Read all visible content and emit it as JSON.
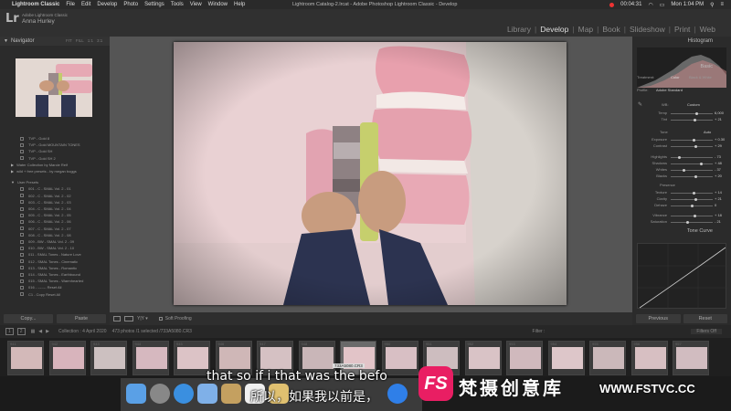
{
  "menubar": {
    "apple": "",
    "items": [
      "Lightroom Classic",
      "File",
      "Edit",
      "Develop",
      "Photo",
      "Settings",
      "Tools",
      "View",
      "Window",
      "Help"
    ],
    "window_title": "Lightroom Catalog-2.lrcat - Adobe Photoshop Lightroom Classic - Develop",
    "timer": "00:04:31",
    "clock": "Mon 1:04 PM"
  },
  "header": {
    "logo": "Lr",
    "product": "Adobe Lightroom Classic",
    "user": "Anna Hurley",
    "modules": [
      "Library",
      "Develop",
      "Map",
      "Book",
      "Slideshow",
      "Print",
      "Web"
    ],
    "active_module": "Develop"
  },
  "left_panel": {
    "navigator_title": "Navigator",
    "zoom_options": [
      "FIT",
      "FILL",
      "1:1",
      "3:1"
    ],
    "presets": [
      {
        "label": "TVP - Gold 8",
        "type": "item"
      },
      {
        "label": "TVP - Gold MOUNTAIN TONES",
        "type": "item"
      },
      {
        "label": "TVP - Gold SH",
        "type": "item"
      },
      {
        "label": "TVP - Gold SH 2",
        "type": "item"
      },
      {
        "label": "Water Collection by Marcie Reif",
        "type": "group"
      },
      {
        "label": "wild + free presets - by megan boggs",
        "type": "group"
      },
      {
        "label": "",
        "type": "spacer"
      },
      {
        "label": "User Presets",
        "type": "group-open"
      },
      {
        "label": "001 - C - SMAL Vol. 2 - 01",
        "type": "item"
      },
      {
        "label": "002 - C - SMAL Vol. 2 - 02",
        "type": "item"
      },
      {
        "label": "003 - C - SMAL Vol. 2 - 03",
        "type": "item"
      },
      {
        "label": "004 - C - SMAL Vol. 2 - 04",
        "type": "item"
      },
      {
        "label": "005 - C - SMAL Vol. 2 - 05",
        "type": "item"
      },
      {
        "label": "006 - C - SMAL Vol. 2 - 06",
        "type": "item"
      },
      {
        "label": "007 - C - SMAL Vol. 2 - 07",
        "type": "item"
      },
      {
        "label": "008 - C - SMAL Vol. 2 - 08",
        "type": "item"
      },
      {
        "label": "009 - BW - SMAL Vol. 2 - 09",
        "type": "item"
      },
      {
        "label": "010 - BW - SMAL Vol. 2 - 10",
        "type": "item"
      },
      {
        "label": "011 - SMAL Tones - Nature Love",
        "type": "item"
      },
      {
        "label": "012 - SMAL Tones - Cinematic",
        "type": "item"
      },
      {
        "label": "013 - SMAL Tones - Romantic",
        "type": "item"
      },
      {
        "label": "014 - SMAL Tones - Earthbound",
        "type": "item"
      },
      {
        "label": "015 - SMAL Tones - Warmhearted",
        "type": "item"
      },
      {
        "label": "016 - ------- Reset All",
        "type": "item"
      },
      {
        "label": "C1 - Copy Reset All",
        "type": "item"
      }
    ],
    "copy_label": "Copy...",
    "paste_label": "Paste"
  },
  "toolbar": {
    "soft_proofing": "Soft Proofing"
  },
  "right_panel": {
    "histogram_title": "Histogram",
    "basic_title": "Basic",
    "treatment_label": "Treatment:",
    "color_label": "Color",
    "bw_label": "Black & White",
    "profile_label": "Profile:",
    "profile_value": "Adobe Standard",
    "wb_label": "WB:",
    "wb_value": "Custom",
    "sliders": [
      {
        "label": "Temp",
        "value": "6,000",
        "pos": 0.62
      },
      {
        "label": "Tint",
        "value": "+ 21",
        "pos": 0.58
      },
      {
        "label": "Exposure",
        "value": "+ 0.30",
        "pos": 0.55
      },
      {
        "label": "Contrast",
        "value": "+ 29",
        "pos": 0.6
      },
      {
        "label": "Highlights",
        "value": "- 73",
        "pos": 0.2
      },
      {
        "label": "Shadows",
        "value": "+ 48",
        "pos": 0.72
      },
      {
        "label": "Whites",
        "value": "- 37",
        "pos": 0.32
      },
      {
        "label": "Blacks",
        "value": "+ 20",
        "pos": 0.6
      },
      {
        "label": "Texture",
        "value": "+ 14",
        "pos": 0.56
      },
      {
        "label": "Clarity",
        "value": "+ 21",
        "pos": 0.6
      },
      {
        "label": "Dehaze",
        "value": "0",
        "pos": 0.5
      },
      {
        "label": "Vibrance",
        "value": "+ 18",
        "pos": 0.58
      },
      {
        "label": "Saturation",
        "value": "- 21",
        "pos": 0.4
      }
    ],
    "tone_label": "Tone",
    "auto_label": "Auto",
    "presence_label": "Presence",
    "tone_curve_title": "Tone Curve",
    "previous_label": "Previous",
    "reset_label": "Reset"
  },
  "filmstrip_bar": {
    "pages": [
      "1",
      "2"
    ],
    "source": "Collection : 4 April 2020",
    "count": "473 photos /1 selected /733A5080.CR3",
    "filter_label": "Filter :",
    "filter_value": "Filters Off"
  },
  "filmstrip": {
    "numbers": [
      "941",
      "942",
      "943",
      "944",
      "945",
      "946",
      "947",
      "948",
      "949",
      "950",
      "951",
      "952",
      "953",
      "954",
      "955",
      "956",
      "957"
    ],
    "tooltip": "733A5080.CR3"
  },
  "overlay": {
    "subtitle_en": "that so if i that was the befo",
    "subtitle_zh": "所以，如果我以前是，",
    "watermark_logo": "FS",
    "watermark_cn": "梵摄创意库",
    "watermark_url": "WWW.FSTVC.CC"
  },
  "colors": {
    "panel": "#2b2b2b",
    "accent_pink": "#e91e63",
    "photo_pink": "#e2a9b5"
  }
}
